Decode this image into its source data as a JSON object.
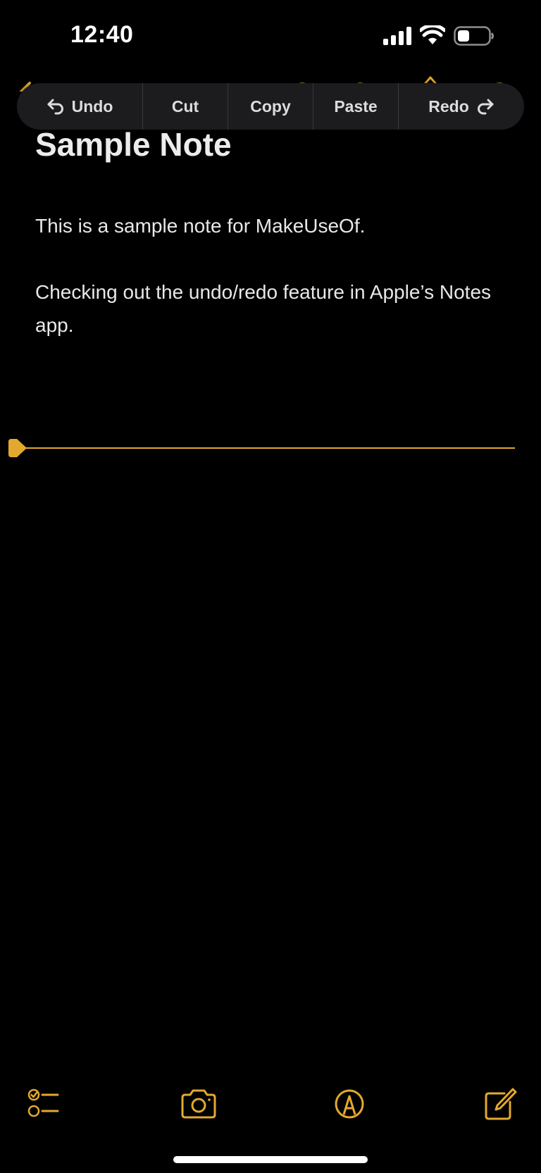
{
  "status_bar": {
    "time": "12:40"
  },
  "edit_menu": {
    "undo_label": "Undo",
    "cut_label": "Cut",
    "copy_label": "Copy",
    "paste_label": "Paste",
    "redo_label": "Redo"
  },
  "note": {
    "title": "Sample Note",
    "paragraphs": [
      "This is a sample note for MakeUseOf.",
      "Checking out the undo/redo feature in Apple’s Notes app."
    ]
  },
  "toolbar": {
    "icons": [
      "checklist-icon",
      "camera-icon",
      "markup-pen-icon",
      "compose-icon"
    ]
  },
  "colors": {
    "accent": "#E3A92E",
    "background": "#000000",
    "menu_background": "#1C1C1E",
    "text": "#E8E8E8"
  }
}
